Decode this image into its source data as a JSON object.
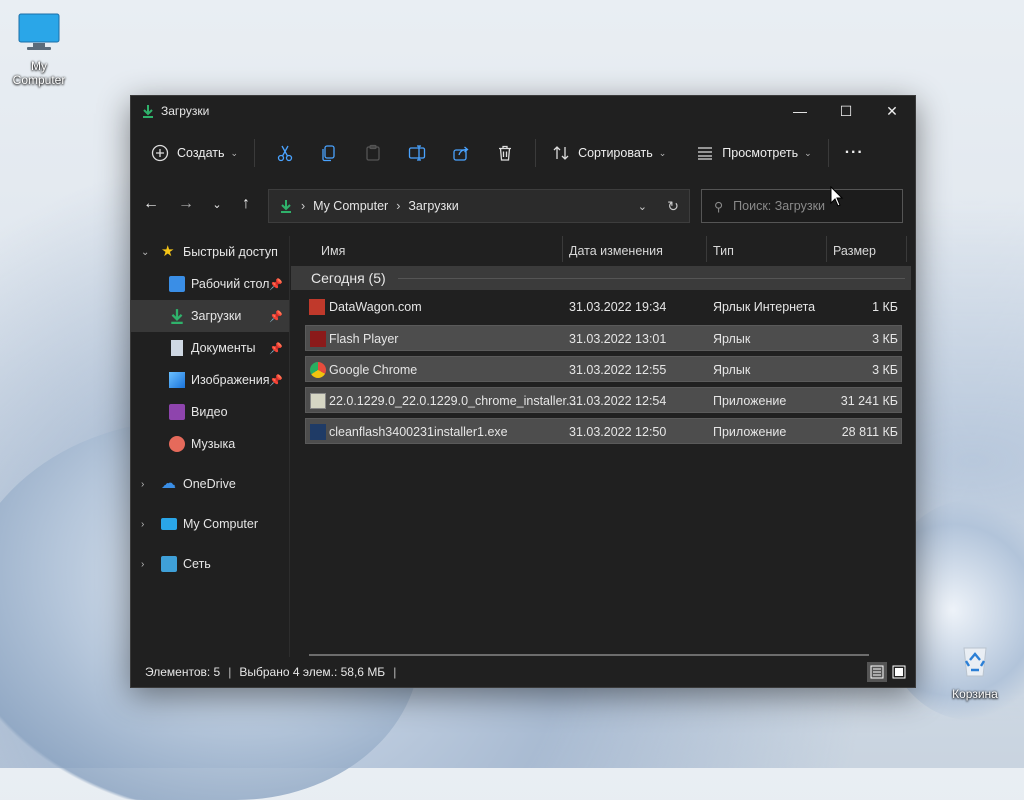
{
  "desktop": {
    "icons": [
      {
        "label": "My Computer"
      },
      {
        "label": "Корзина"
      }
    ]
  },
  "window": {
    "title": "Загрузки",
    "controls": {
      "minimize": "—",
      "maximize": "☐",
      "close": "✕"
    }
  },
  "toolbar": {
    "create_label": "Создать",
    "sort_label": "Сортировать",
    "view_label": "Просмотреть",
    "more_label": "···"
  },
  "address": {
    "crumbs": [
      "My Computer",
      "Загрузки"
    ],
    "search_placeholder": "Поиск: Загрузки"
  },
  "nav": {
    "items": [
      {
        "label": "Быстрый доступ"
      },
      {
        "label": "Рабочий стол"
      },
      {
        "label": "Загрузки"
      },
      {
        "label": "Документы"
      },
      {
        "label": "Изображения"
      },
      {
        "label": "Видео"
      },
      {
        "label": "Музыка"
      },
      {
        "label": "OneDrive"
      },
      {
        "label": "My Computer"
      },
      {
        "label": "Сеть"
      }
    ]
  },
  "columns": {
    "name": "Имя",
    "date": "Дата изменения",
    "type": "Тип",
    "size": "Размер"
  },
  "group": {
    "label": "Сегодня (5)"
  },
  "files": [
    {
      "name": "DataWagon.com",
      "date": "31.03.2022 19:34",
      "type": "Ярлык Интернета",
      "size": "1 КБ",
      "selected": false
    },
    {
      "name": "Flash Player",
      "date": "31.03.2022 13:01",
      "type": "Ярлык",
      "size": "3 КБ",
      "selected": true
    },
    {
      "name": "Google Chrome",
      "date": "31.03.2022 12:55",
      "type": "Ярлык",
      "size": "3 КБ",
      "selected": true
    },
    {
      "name": "22.0.1229.0_22.0.1229.0_chrome_installer....",
      "date": "31.03.2022 12:54",
      "type": "Приложение",
      "size": "31 241 КБ",
      "selected": true
    },
    {
      "name": "cleanflash3400231installer1.exe",
      "date": "31.03.2022 12:50",
      "type": "Приложение",
      "size": "28 811 КБ",
      "selected": true
    }
  ],
  "status": {
    "count": "Элементов: 5",
    "selection": "Выбрано 4 элем.: 58,6 МБ"
  },
  "colors": {
    "window_bg": "#202020",
    "selection_bg": "#4d4d4d",
    "accent_green": "#2fb26b",
    "folder_blue": "#3a8ee6"
  }
}
